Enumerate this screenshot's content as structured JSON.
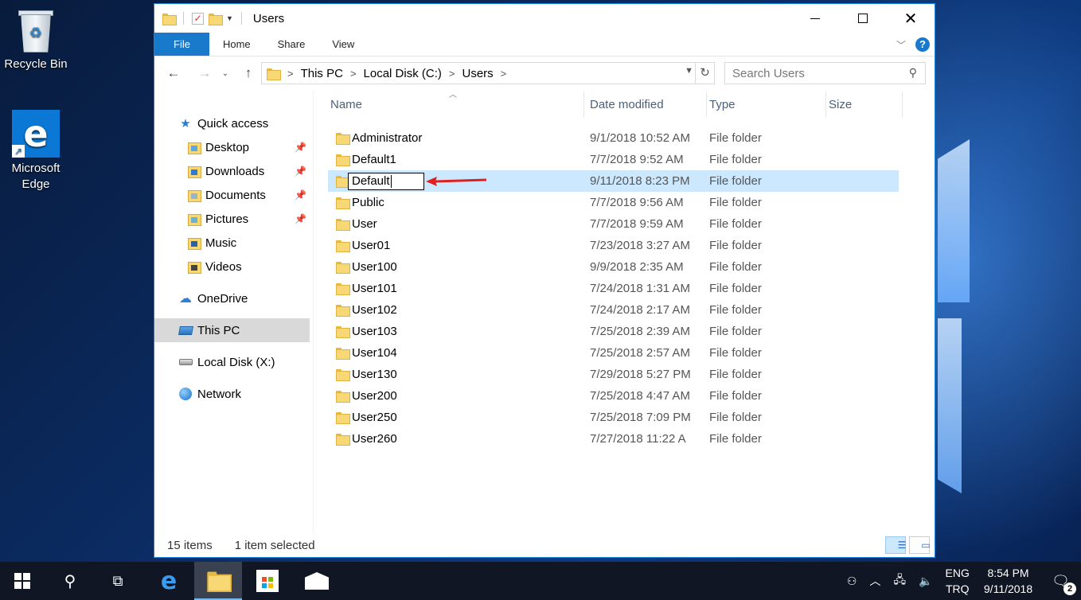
{
  "desktop": {
    "icons": [
      {
        "label": "Recycle Bin",
        "icon": "recycle-bin-icon"
      },
      {
        "label": "Microsoft Edge",
        "icon": "edge-icon"
      }
    ]
  },
  "window": {
    "title": "Users",
    "ribbon_tabs": [
      "File",
      "Home",
      "Share",
      "View"
    ],
    "address": {
      "crumbs": [
        "This PC",
        "Local Disk (C:)",
        "Users"
      ]
    },
    "search": {
      "placeholder": "Search Users"
    },
    "nav_pane": {
      "quick_access": "Quick access",
      "pinned": [
        {
          "label": "Desktop",
          "pinned": true
        },
        {
          "label": "Downloads",
          "pinned": true
        },
        {
          "label": "Documents",
          "pinned": true
        },
        {
          "label": "Pictures",
          "pinned": true
        },
        {
          "label": "Music",
          "pinned": false
        },
        {
          "label": "Videos",
          "pinned": false
        }
      ],
      "onedrive": "OneDrive",
      "this_pc": "This PC",
      "local_disk": "Local Disk (X:)",
      "network": "Network"
    },
    "columns": [
      "Name",
      "Date modified",
      "Type",
      "Size"
    ],
    "files": [
      {
        "name": "Administrator",
        "date": "9/1/2018 10:52 AM",
        "type": "File folder"
      },
      {
        "name": "Default1",
        "date": "7/7/2018 9:52 AM",
        "type": "File folder"
      },
      {
        "name": "Default",
        "date": "9/11/2018 8:23 PM",
        "type": "File folder",
        "selected": true,
        "renaming": true
      },
      {
        "name": "Public",
        "date": "7/7/2018 9:56 AM",
        "type": "File folder"
      },
      {
        "name": "User",
        "date": "7/7/2018 9:59 AM",
        "type": "File folder"
      },
      {
        "name": "User01",
        "date": "7/23/2018 3:27 AM",
        "type": "File folder"
      },
      {
        "name": "User100",
        "date": "9/9/2018 2:35 AM",
        "type": "File folder"
      },
      {
        "name": "User101",
        "date": "7/24/2018 1:31 AM",
        "type": "File folder"
      },
      {
        "name": "User102",
        "date": "7/24/2018 2:17 AM",
        "type": "File folder"
      },
      {
        "name": "User103",
        "date": "7/25/2018 2:39 AM",
        "type": "File folder"
      },
      {
        "name": "User104",
        "date": "7/25/2018 2:57 AM",
        "type": "File folder"
      },
      {
        "name": "User130",
        "date": "7/29/2018 5:27 PM",
        "type": "File folder"
      },
      {
        "name": "User200",
        "date": "7/25/2018 4:47 AM",
        "type": "File folder"
      },
      {
        "name": "User250",
        "date": "7/25/2018 7:09 PM",
        "type": "File folder"
      },
      {
        "name": "User260",
        "date": "7/27/2018 11:22 A",
        "type": "File folder"
      }
    ],
    "status": {
      "count": "15 items",
      "selection": "1 item selected"
    }
  },
  "taskbar": {
    "lang_top": "ENG",
    "lang_bottom": "TRQ",
    "time": "8:54 PM",
    "date": "9/11/2018",
    "notification_count": "2"
  },
  "colors": {
    "accent": "#1979ca",
    "selection": "#cce8ff",
    "annotation_arrow": "#e02020"
  }
}
